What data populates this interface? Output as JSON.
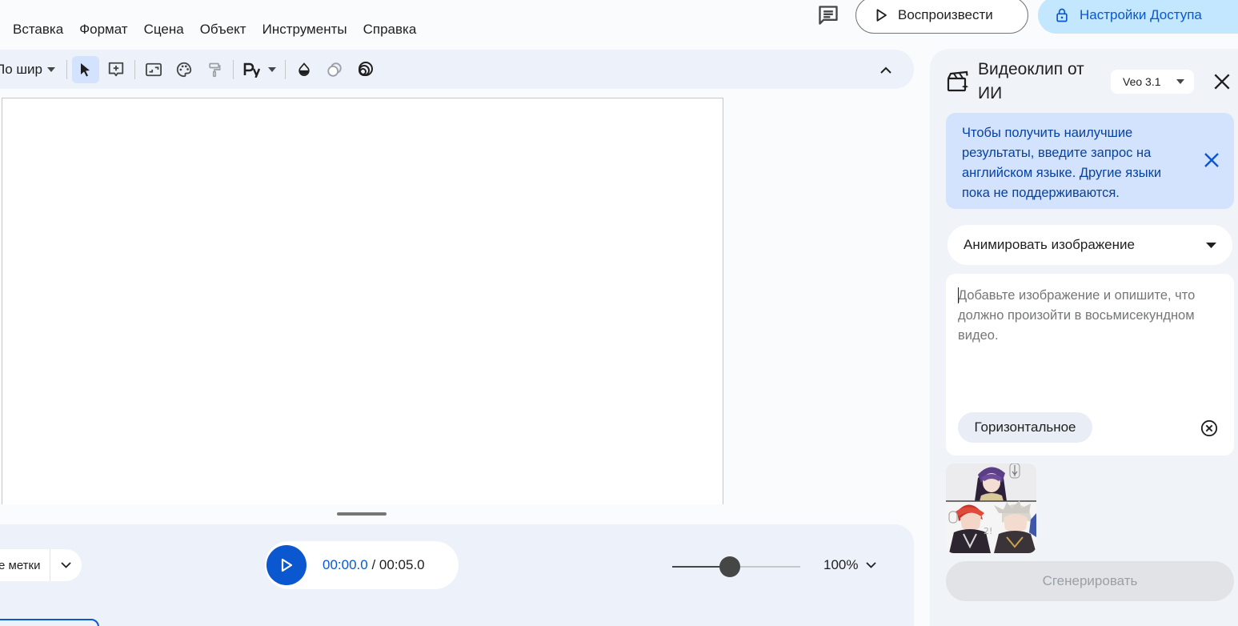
{
  "menu": [
    "Вставка",
    "Формат",
    "Сцена",
    "Объект",
    "Инструменты",
    "Справка"
  ],
  "header": {
    "play_label": "Воспроизвести",
    "share_label": "Настройки Доступа"
  },
  "toolbar": {
    "zoom_label": "По шир"
  },
  "timeline": {
    "labels_text": "е метки",
    "current_time": "00:00.0",
    "separator": " / ",
    "total_time": "00:05.0",
    "zoom_level": 0.45,
    "zoom_percent": "100%"
  },
  "side_panel": {
    "title": "Видеоклип от ИИ",
    "model": "Veo 3.1",
    "info_text": "Чтобы получить наилучшие результаты, введите запрос на английском языке. Другие языки пока не поддерживаются.",
    "mode": "Анимировать изображение",
    "prompt_value": "",
    "prompt_placeholder": "Добавьте изображение и опишите, что должно произойти в восьмисекундном видео.",
    "orientation": "Горизонтальное",
    "generate_label": "Сгенерировать"
  },
  "colors": {
    "accent": "#0b57d0",
    "share_bg": "#c2e7ff",
    "info_bg": "#d3e3fd",
    "panel_bg": "#f0f4f9",
    "toolbar_bg": "#edf2fa"
  },
  "icons": {
    "comment": "comment-icon",
    "play": "play-icon",
    "lock": "lock-icon",
    "select": "cursor-arrow-icon",
    "text_box": "add-text-box-icon",
    "image": "image-icon",
    "palette": "palette-icon",
    "paint_format": "paint-format-icon",
    "font": "font-icon",
    "fill": "fill-color-icon",
    "opacity": "opacity-icon",
    "rings": "rings-icon",
    "collapse": "chevron-up-icon",
    "ai_video": "ai-video-clip-icon",
    "close": "close-icon"
  }
}
